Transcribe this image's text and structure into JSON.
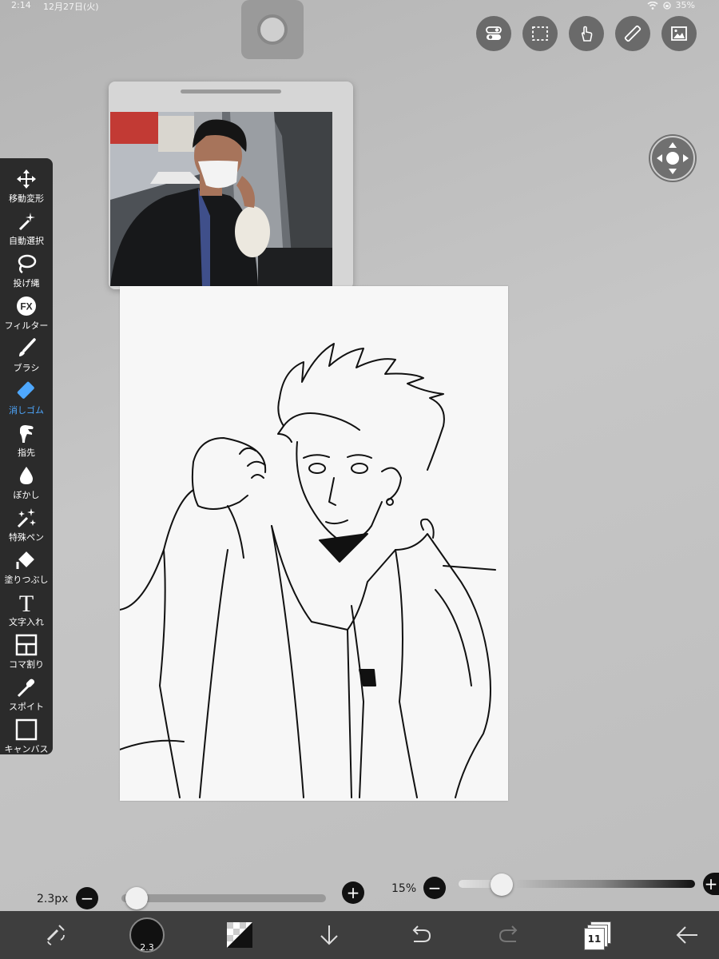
{
  "status_bar": {
    "time": "2:14",
    "date": "12月27日(火)",
    "battery": "35%"
  },
  "top_buttons": [
    {
      "icon": "toggle-switch-icon"
    },
    {
      "icon": "selection-rect-icon"
    },
    {
      "icon": "touch-hand-icon"
    },
    {
      "icon": "ruler-icon"
    },
    {
      "icon": "image-material-icon"
    }
  ],
  "tools": [
    {
      "label": "移動変形",
      "icon": "move-transform-icon"
    },
    {
      "label": "自動選択",
      "icon": "magic-wand-icon"
    },
    {
      "label": "投げ縄",
      "icon": "lasso-icon"
    },
    {
      "label": "フィルター",
      "icon": "fx-filter-icon"
    },
    {
      "label": "ブラシ",
      "icon": "brush-icon"
    },
    {
      "label": "消しゴム",
      "icon": "eraser-icon",
      "active": true
    },
    {
      "label": "指先",
      "icon": "finger-smudge-icon"
    },
    {
      "label": "ぼかし",
      "icon": "blur-drop-icon"
    },
    {
      "label": "特殊ペン",
      "icon": "sparkle-pen-icon"
    },
    {
      "label": "塗りつぶし",
      "icon": "bucket-fill-icon"
    },
    {
      "label": "文字入れ",
      "icon": "text-icon"
    },
    {
      "label": "コマ割り",
      "icon": "panel-split-icon"
    },
    {
      "label": "スポイト",
      "icon": "eyedropper-icon"
    },
    {
      "label": "キャンバス",
      "icon": "canvas-icon"
    }
  ],
  "fx_text": "FX",
  "text_tool_glyph": "T",
  "brush_size": {
    "value_text": "2.3px",
    "level": 0.02
  },
  "opacity": {
    "value_text": "15%",
    "level": 0.15
  },
  "bottom_bar": {
    "color_brush_size": "2.3",
    "layers_count": "11"
  },
  "colors": {
    "accent": "#4ea8ff",
    "toolbar_bg": "#2b2b2b",
    "bottom_bar_bg": "#3e3e3e",
    "button_bg": "#6a6a6a"
  }
}
